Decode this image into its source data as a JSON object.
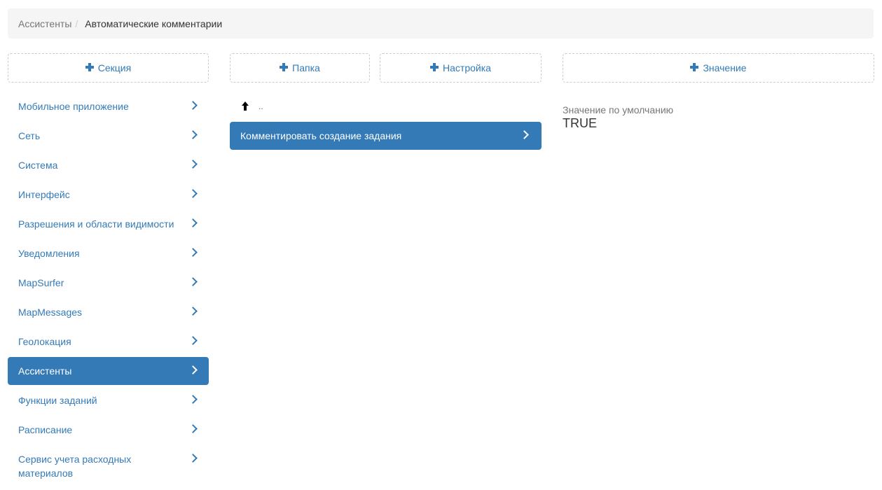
{
  "breadcrumb": {
    "parent": "Ассистенты",
    "separator": "/",
    "current": "Автоматические комментарии"
  },
  "buttons": {
    "section": "Секция",
    "folder": "Папка",
    "setting": "Настройка",
    "value": "Значение"
  },
  "sidebar": {
    "items": [
      {
        "label": "Мобильное приложение"
      },
      {
        "label": "Сеть"
      },
      {
        "label": "Система"
      },
      {
        "label": "Интерфейс"
      },
      {
        "label": "Разрешения и области видимости"
      },
      {
        "label": "Уведомления"
      },
      {
        "label": "MapSurfer"
      },
      {
        "label": "MapMessages"
      },
      {
        "label": "Геолокация"
      },
      {
        "label": "Ассистенты",
        "active": true
      },
      {
        "label": "Функции заданий"
      },
      {
        "label": "Расписание"
      },
      {
        "label": "Сервис учета расходных материалов"
      }
    ]
  },
  "folder_list": {
    "up_label": "..",
    "items": [
      {
        "label": "Комментировать создание задания",
        "active": true
      }
    ]
  },
  "value_panel": {
    "label": "Значение по умолчанию",
    "value": "TRUE"
  },
  "colors": {
    "accent": "#337ab7",
    "breadcrumb_bg": "#f5f5f5"
  }
}
